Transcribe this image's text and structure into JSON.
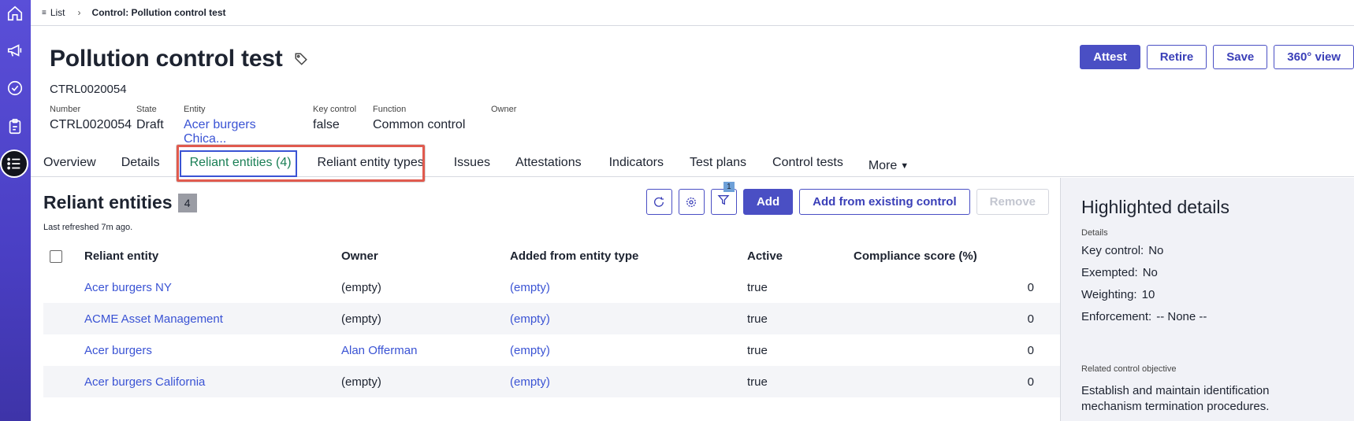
{
  "breadcrumb": {
    "list_label": "List",
    "current": "Control: Pollution control test"
  },
  "record": {
    "title": "Pollution control test",
    "id": "CTRL0020054",
    "fields": [
      {
        "label": "Number",
        "value": "CTRL0020054",
        "link": false
      },
      {
        "label": "State",
        "value": "Draft",
        "link": false
      },
      {
        "label": "Entity",
        "value": "Acer burgers Chica...",
        "link": true
      },
      {
        "label": "Key control",
        "value": "false",
        "link": false
      },
      {
        "label": "Function",
        "value": "Common control",
        "link": false
      },
      {
        "label": "Owner",
        "value": "",
        "link": false
      }
    ]
  },
  "actions": {
    "attest": "Attest",
    "retire": "Retire",
    "save": "Save",
    "view360": "360° view"
  },
  "tabs": [
    {
      "label": "Overview"
    },
    {
      "label": "Details"
    },
    {
      "label": "Reliant entities (4)"
    },
    {
      "label": "Reliant entity types"
    },
    {
      "label": "Issues"
    },
    {
      "label": "Attestations"
    },
    {
      "label": "Indicators"
    },
    {
      "label": "Test plans"
    },
    {
      "label": "Control tests"
    },
    {
      "label": "More"
    }
  ],
  "section": {
    "title": "Reliant entities",
    "count": "4",
    "refreshed": "Last refreshed 7m ago.",
    "filter_count": "1",
    "add_label": "Add",
    "add_existing_label": "Add from existing control",
    "remove_label": "Remove"
  },
  "table": {
    "columns": [
      "Reliant entity",
      "Owner",
      "Added from entity type",
      "Active",
      "Compliance score (%)"
    ],
    "rows": [
      {
        "entity": "Acer burgers NY",
        "owner": "(empty)",
        "owner_link": false,
        "type": "(empty)",
        "active": "true",
        "score": "0"
      },
      {
        "entity": "ACME Asset Management",
        "owner": "(empty)",
        "owner_link": false,
        "type": "(empty)",
        "active": "true",
        "score": "0"
      },
      {
        "entity": "Acer burgers",
        "owner": "Alan Offerman",
        "owner_link": true,
        "type": "(empty)",
        "active": "true",
        "score": "0"
      },
      {
        "entity": "Acer burgers California",
        "owner": "(empty)",
        "owner_link": false,
        "type": "(empty)",
        "active": "true",
        "score": "0"
      }
    ]
  },
  "panel": {
    "title": "Highlighted details",
    "details_label": "Details",
    "key_control_label": "Key control:",
    "key_control_value": "No",
    "exempted_label": "Exempted:",
    "exempted_value": "No",
    "weighting_label": "Weighting:",
    "weighting_value": "10",
    "enforcement_label": "Enforcement:",
    "enforcement_value": "-- None --",
    "objective_label": "Related control objective",
    "objective_text": "Establish and maintain identification mechanism termination procedures."
  },
  "colors": {
    "accent": "#4a4fc4",
    "link": "#3a53d4",
    "active_tab": "#1a7f55",
    "highlight": "#e05a4e",
    "rail": "#4a3fc4"
  },
  "icons": [
    "home-icon",
    "megaphone-icon",
    "check-circle-icon",
    "clipboard-icon",
    "list-icon",
    "tag-icon",
    "refresh-icon",
    "gear-icon",
    "filter-icon",
    "chevron-down-icon"
  ]
}
